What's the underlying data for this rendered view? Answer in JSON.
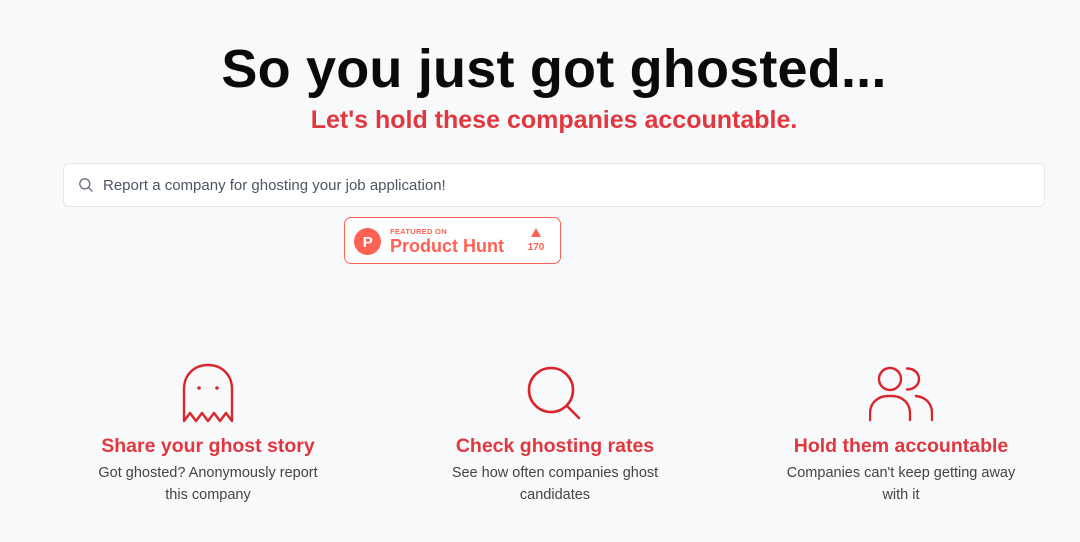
{
  "hero": {
    "title": "So you just got ghosted...",
    "subtitle": "Let's hold these companies accountable."
  },
  "search": {
    "icon": "search-icon",
    "placeholder": "Report a company for ghosting your job application!"
  },
  "product_hunt_badge": {
    "featured_label": "FEATURED ON",
    "name": "Product Hunt",
    "logo_letter": "P",
    "vote_count": "170",
    "upvote_icon": "triangle-up-icon"
  },
  "features": [
    {
      "icon": "ghost-icon",
      "title": "Share your ghost story",
      "description": "Got ghosted? Anonymously report this company"
    },
    {
      "icon": "magnifier-icon",
      "title": "Check ghosting rates",
      "description": "See how often companies ghost candidates"
    },
    {
      "icon": "users-icon",
      "title": "Hold them accountable",
      "description": "Companies can't keep getting away with it"
    }
  ],
  "colors": {
    "accent": "#e0383e",
    "icon_stroke": "#d9262c",
    "product_hunt": "#ff6154",
    "background": "#f8f9fb"
  }
}
